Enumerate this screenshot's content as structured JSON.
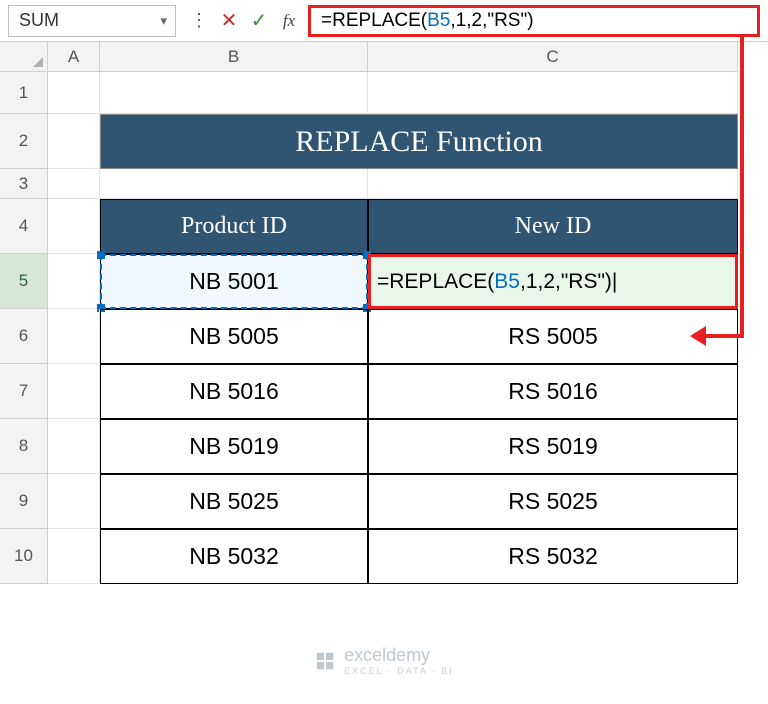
{
  "nameBox": "SUM",
  "formulaBar": {
    "prefix": "=REPLACE(",
    "ref": "B5",
    "suffix": ",1,2,\"RS\")"
  },
  "columns": {
    "A": "A",
    "B": "B",
    "C": "C"
  },
  "rowNums": [
    "1",
    "2",
    "3",
    "4",
    "5",
    "6",
    "7",
    "8",
    "9",
    "10"
  ],
  "title": "REPLACE Function",
  "headers": {
    "productId": "Product ID",
    "newId": "New ID"
  },
  "editingFormula": {
    "prefix": "=REPLACE(",
    "ref": "B5",
    "suffix": ",1,2,\"RS\")"
  },
  "data": [
    {
      "pid": "NB 5001",
      "nid": ""
    },
    {
      "pid": "NB 5005",
      "nid": "RS 5005"
    },
    {
      "pid": "NB 5016",
      "nid": "RS 5016"
    },
    {
      "pid": "NB 5019",
      "nid": "RS 5019"
    },
    {
      "pid": "NB 5025",
      "nid": "RS 5025"
    },
    {
      "pid": "NB 5032",
      "nid": "RS 5032"
    }
  ],
  "watermark": {
    "brand": "exceldemy",
    "tagline": "EXCEL · DATA · BI"
  }
}
